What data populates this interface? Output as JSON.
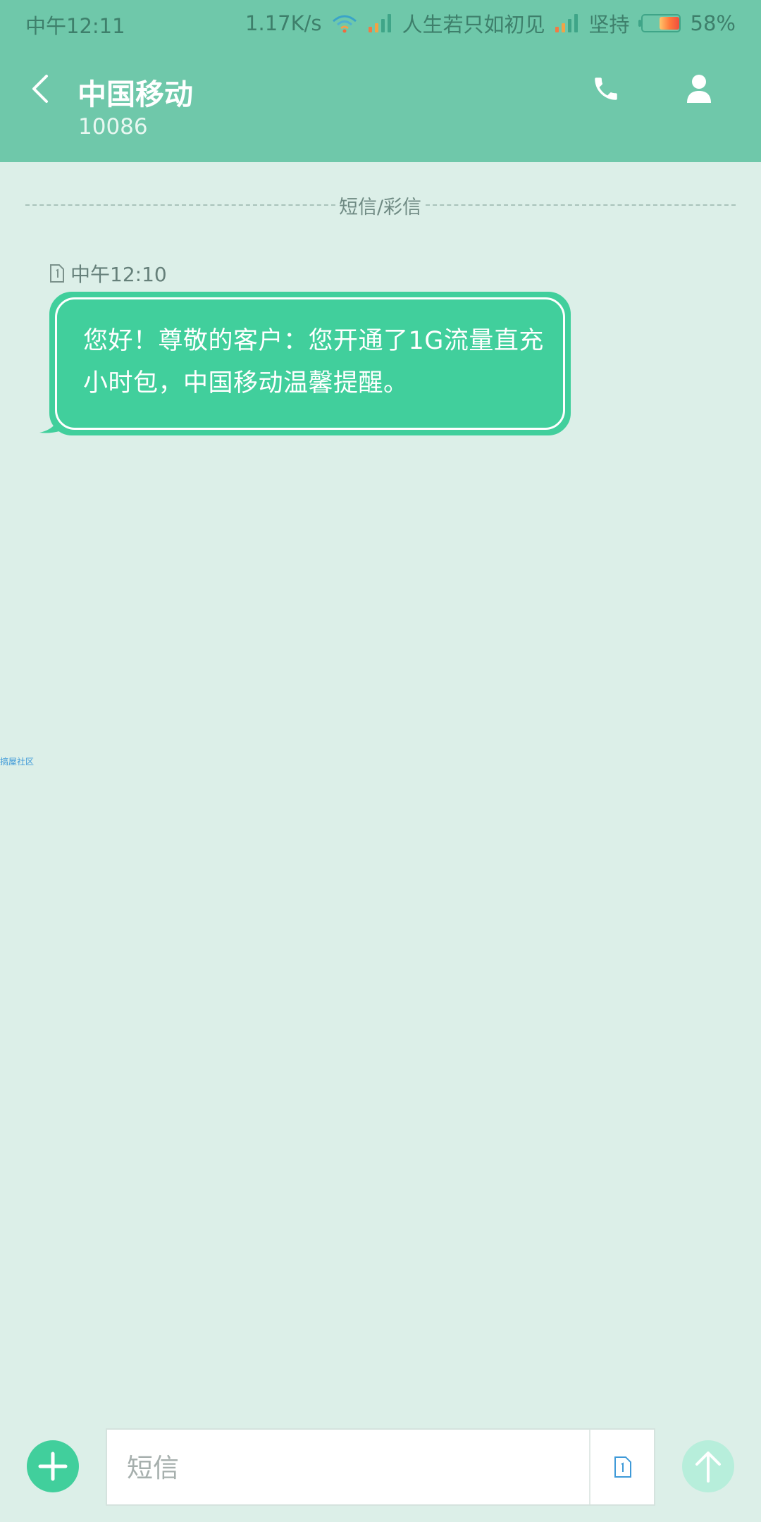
{
  "status_bar": {
    "time": "中午12:11",
    "net_speed": "1.17K/s",
    "carrier_1": "人生若只如初见",
    "carrier_2": "坚持",
    "battery_percent_label": "58%",
    "battery_level": 0.58,
    "icons": [
      "wifi-icon",
      "signal-icon",
      "signal-icon",
      "battery-icon"
    ]
  },
  "header": {
    "contact_name": "中国移动",
    "contact_number": "10086",
    "icons": [
      "back-icon",
      "phone-icon",
      "person-icon"
    ]
  },
  "conversation": {
    "divider_label": "短信/彩信",
    "messages": [
      {
        "sim_icon": "sim-1-icon",
        "time": "中午12:10",
        "text": "您好！尊敬的客户：您开通了1G流量直充小时包，中国移动温馨提醒。"
      }
    ],
    "watermark": "搞屋社区"
  },
  "composer": {
    "placeholder": "短信",
    "value": "",
    "icons": [
      "add-icon",
      "sim-1-icon",
      "send-arrow-icon"
    ]
  },
  "colors": {
    "header_green": "#6fc8aa",
    "bubble_green": "#41cf9c",
    "background": "#dcefe8",
    "send_disabled": "#b7eedb"
  }
}
